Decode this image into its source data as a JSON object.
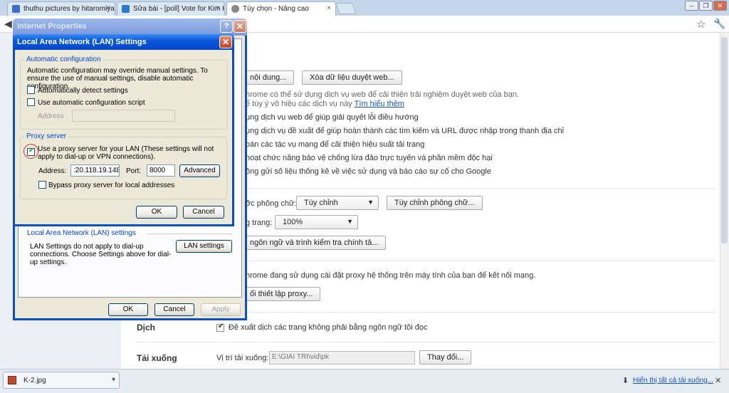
{
  "tabs": [
    {
      "title": "thuthu pictures by hitaromiyar",
      "close": "×",
      "icon_color": "#3b6ec9"
    },
    {
      "title": "Sửa bài - [poll] Vote for Kim Hy",
      "close": "×",
      "icon_color": "#2a7ad1"
    },
    {
      "title": "Tùy chọn - Nâng cao",
      "close": "×",
      "icon_color": "#666666"
    }
  ],
  "window_controls": {
    "minimize": "–",
    "restore": "❐",
    "close": "✕"
  },
  "toolbar": {
    "back_icon": "◀",
    "star_icon": "☆",
    "wrench_icon": "🔧"
  },
  "settings": {
    "privacy": {
      "content_button": "nội dung...",
      "clear_button": "Xóa dữ liệu duyệt web...",
      "description_line1": "hrome có thể sử dụng dịch vụ web để cải thiện trải nghiệm duyệt web của bạn.",
      "description_line2": "ể tùy ý vô hiệu các dịch vụ này",
      "learn_more": "Tìm hiểu thêm",
      "options": [
        "ụng dịch vụ web để giúp giải quyết lỗi điều hướng",
        "ụng dịch vụ đề xuất để giúp hoàn thành các tìm kiếm và URL được nhập trong thanh địa chỉ",
        "oán các tác vụ mạng để cải thiện hiệu suất tải trang",
        "hoạt chức năng bảo vệ chống lừa đảo trực tuyến và phần mềm độc hại",
        "ông gửi số liệu thống kê về việc sử dụng và báo cáo sự cố cho Google"
      ]
    },
    "web_content": {
      "font_size_label": "ỡc phông chữ:",
      "font_size_value": "Tùy chỉnh",
      "customize_fonts": "Tùy chỉnh phông chữ...",
      "zoom_label": "g trang:",
      "zoom_value": "100%",
      "languages_button": "ngôn ngữ và trình kiểm tra chính tả..."
    },
    "network": {
      "description": "hrome đang sử dụng cài đặt proxy hệ thống trên máy tính của bạn để kết nối mạng.",
      "proxy_button": "ổi thiết lập proxy..."
    },
    "translate": {
      "heading": "Dịch",
      "option": "Đề xuất dịch các trang không phải bằng ngôn ngữ tôi đọc",
      "checked": true
    },
    "downloads": {
      "heading": "Tải xuống",
      "location_label": "Vị trí tải xuống:",
      "location_value": "E:\\GIAI TRI\\vid\\pk",
      "change_button": "Thay đổi..."
    }
  },
  "internet_properties": {
    "title": "Internet Properties",
    "help": "?",
    "close": "✕",
    "lan_section_label": "Local Area Network (LAN) settings",
    "lan_description": "LAN Settings do not apply to dial-up connections. Choose Settings above for dial-up settings.",
    "lan_settings_button": "LAN settings",
    "ok": "OK",
    "cancel": "Cancel",
    "apply": "Apply"
  },
  "lan_dialog": {
    "title": "Local Area Network (LAN) Settings",
    "close": "✕",
    "auto_config_label": "Automatic configuration",
    "auto_config_desc": "Automatic configuration may override manual settings.  To ensure the use of manual settings, disable automatic configuration.",
    "auto_detect": {
      "label": "Automatically detect settings",
      "checked": false
    },
    "auto_script": {
      "label": "Use automatic configuration script",
      "checked": false
    },
    "address_label": "Address",
    "proxy_label": "Proxy server",
    "use_proxy": {
      "label": "Use a proxy server for your LAN (These settings will not apply to dial-up or VPN connections).",
      "checked": true
    },
    "proxy_address_label": "Address:",
    "proxy_address_value": ":20.118.19.148",
    "port_label": "Port:",
    "port_value": "8000",
    "advanced_button": "Advanced",
    "bypass": {
      "label": "Bypass proxy server for local addresses",
      "checked": false
    },
    "ok": "OK",
    "cancel": "Cancel",
    "highlight_color": "#d03030"
  },
  "download_bar": {
    "file_name": "K-2.jpg",
    "menu_arrow": "▾",
    "show_all": "Hiển thị tất cả tải xuống...",
    "close": "✕"
  }
}
